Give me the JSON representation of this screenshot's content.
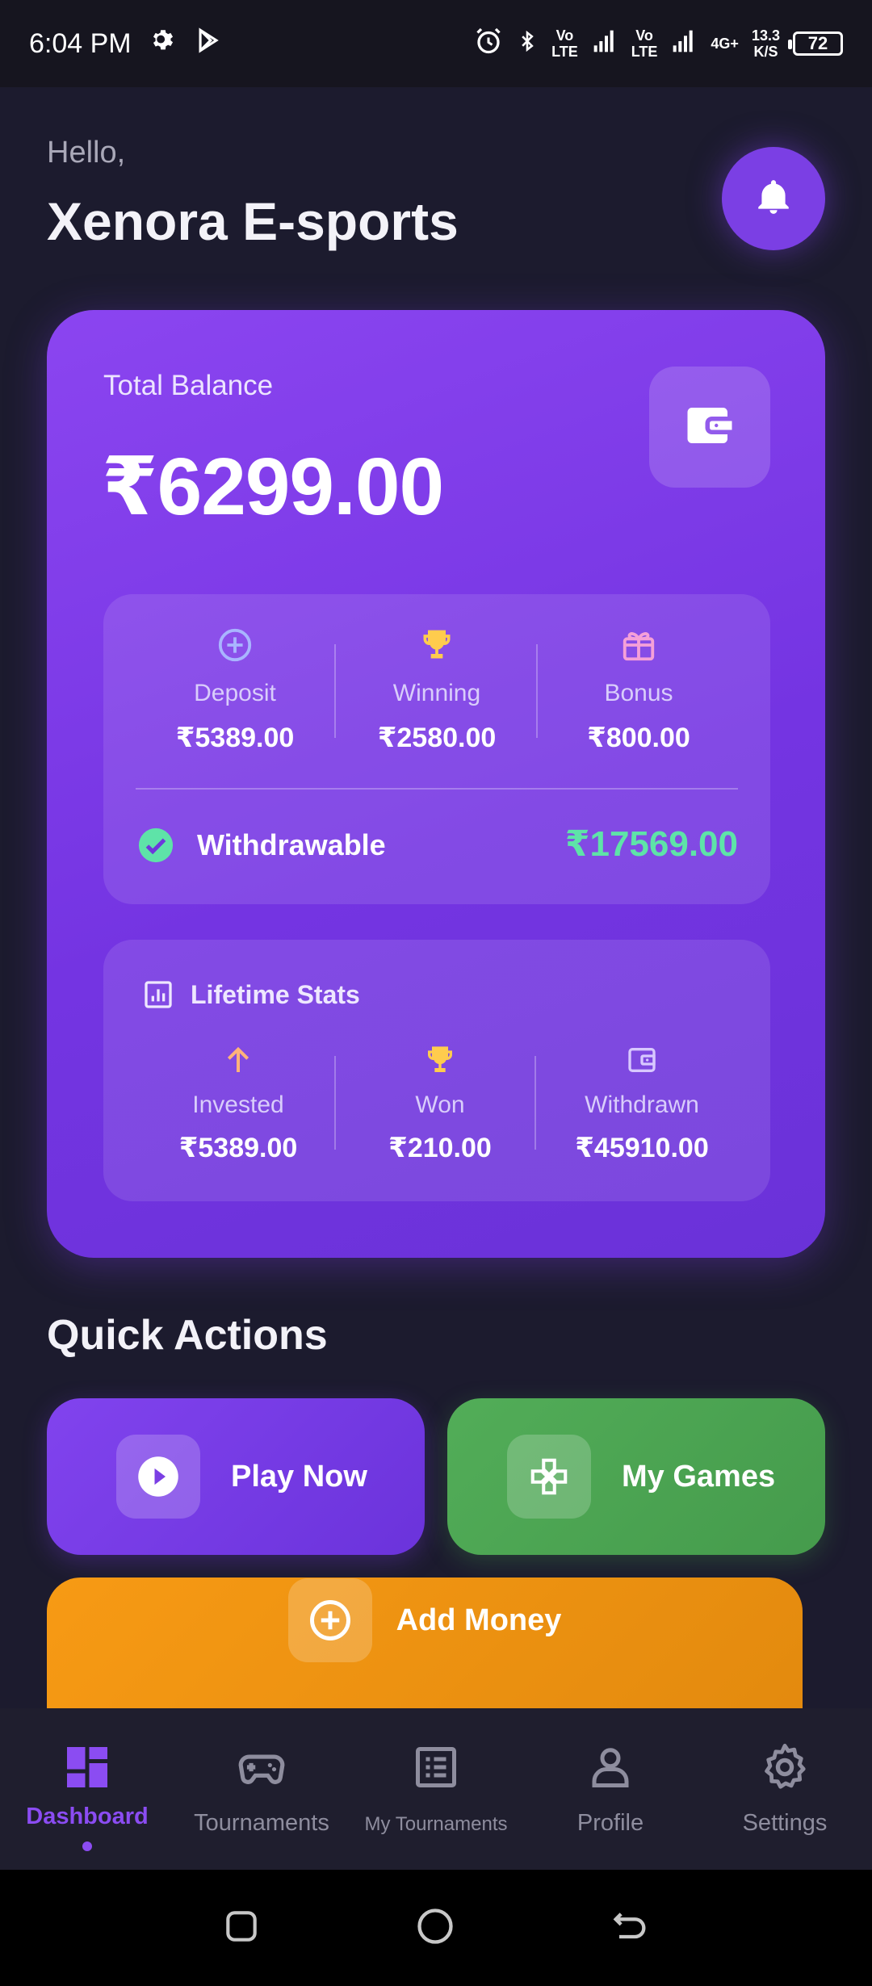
{
  "status_bar": {
    "time": "6:04 PM",
    "net1": "Vo",
    "net1b": "LTE",
    "net2": "Vo",
    "net2b": "LTE",
    "net3": "4G+",
    "speed_value": "13.3",
    "speed_unit": "K/S",
    "battery": "72"
  },
  "header": {
    "greeting": "Hello,",
    "username": "Xenora E-sports"
  },
  "balance": {
    "label": "Total Balance",
    "amount": "₹6299.00",
    "breakdown": [
      {
        "label": "Deposit",
        "value": "₹5389.00",
        "icon": "plus-circle-icon"
      },
      {
        "label": "Winning",
        "value": "₹2580.00",
        "icon": "trophy-icon"
      },
      {
        "label": "Bonus",
        "value": "₹800.00",
        "icon": "gift-icon"
      }
    ],
    "withdrawable_label": "Withdrawable",
    "withdrawable_value": "₹17569.00"
  },
  "lifetime": {
    "title": "Lifetime Stats",
    "stats": [
      {
        "label": "Invested",
        "value": "₹5389.00",
        "icon": "arrow-up-icon"
      },
      {
        "label": "Won",
        "value": "₹210.00",
        "icon": "trophy-icon"
      },
      {
        "label": "Withdrawn",
        "value": "₹45910.00",
        "icon": "wallet-icon"
      }
    ]
  },
  "quick_actions": {
    "title": "Quick Actions",
    "play": "Play Now",
    "games": "My Games",
    "money": "Add Money"
  },
  "nav": {
    "items": [
      {
        "label": "Dashboard",
        "icon": "dashboard-icon",
        "active": true
      },
      {
        "label": "Tournaments",
        "icon": "gamepad-icon"
      },
      {
        "label": "My Tournaments",
        "icon": "list-icon"
      },
      {
        "label": "Profile",
        "icon": "person-icon"
      },
      {
        "label": "Settings",
        "icon": "gear-icon"
      }
    ]
  },
  "colors": {
    "background": "#1c1b2e",
    "accent": "#7b3fe4",
    "success": "#5ee3a8",
    "green": "#4caf50",
    "orange": "#f79a14"
  }
}
